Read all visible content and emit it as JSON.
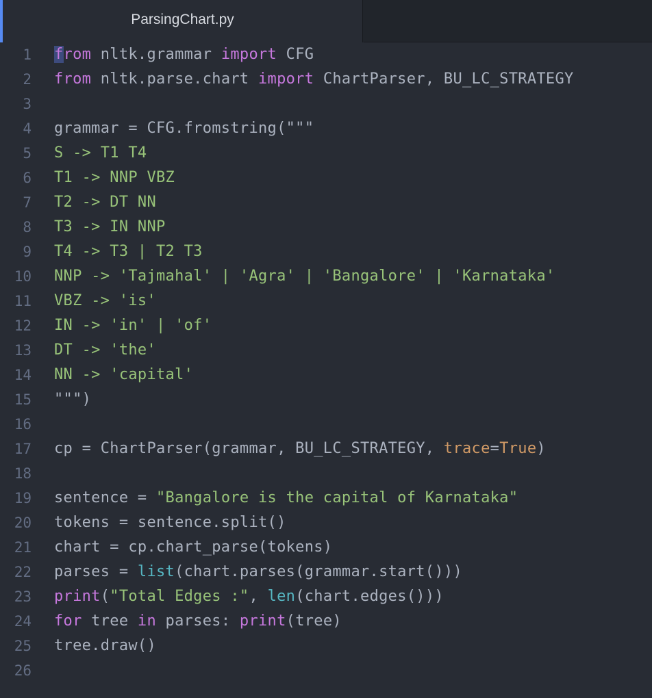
{
  "tab": {
    "title": "ParsingChart.py"
  },
  "colors": {
    "keyword": "#c678dd",
    "plain": "#abb2bf",
    "string": "#98c379",
    "builtin": "#56b6c2",
    "param": "#d19a66",
    "constant": "#d19a66"
  },
  "lines": [
    {
      "n": "1",
      "tokens": [
        {
          "t": "from",
          "c": "keyword"
        },
        {
          "t": " nltk.grammar ",
          "c": "plain"
        },
        {
          "t": "import",
          "c": "keyword"
        },
        {
          "t": " CFG",
          "c": "plain"
        }
      ]
    },
    {
      "n": "2",
      "tokens": [
        {
          "t": "from",
          "c": "keyword"
        },
        {
          "t": " nltk.parse.chart ",
          "c": "plain"
        },
        {
          "t": "import",
          "c": "keyword"
        },
        {
          "t": " ChartParser, BU_LC_STRATEGY",
          "c": "plain"
        }
      ]
    },
    {
      "n": "3",
      "tokens": []
    },
    {
      "n": "4",
      "tokens": [
        {
          "t": "grammar = CFG.fromstring(",
          "c": "plain"
        },
        {
          "t": "\"\"\"",
          "c": "plain"
        }
      ]
    },
    {
      "n": "5",
      "tokens": [
        {
          "t": "S -> T1 T4",
          "c": "string"
        }
      ]
    },
    {
      "n": "6",
      "tokens": [
        {
          "t": "T1 -> NNP VBZ",
          "c": "string"
        }
      ]
    },
    {
      "n": "7",
      "tokens": [
        {
          "t": "T2 -> DT NN",
          "c": "string"
        }
      ]
    },
    {
      "n": "8",
      "tokens": [
        {
          "t": "T3 -> IN NNP",
          "c": "string"
        }
      ]
    },
    {
      "n": "9",
      "tokens": [
        {
          "t": "T4 -> T3 | T2 T3",
          "c": "string"
        }
      ]
    },
    {
      "n": "10",
      "tokens": [
        {
          "t": "NNP -> 'Tajmahal' | 'Agra' | 'Bangalore' | 'Karnataka'",
          "c": "string"
        }
      ]
    },
    {
      "n": "11",
      "tokens": [
        {
          "t": "VBZ -> 'is'",
          "c": "string"
        }
      ]
    },
    {
      "n": "12",
      "tokens": [
        {
          "t": "IN -> 'in' | 'of'",
          "c": "string"
        }
      ]
    },
    {
      "n": "13",
      "tokens": [
        {
          "t": "DT -> 'the'",
          "c": "string"
        }
      ]
    },
    {
      "n": "14",
      "tokens": [
        {
          "t": "NN -> 'capital'",
          "c": "string"
        }
      ]
    },
    {
      "n": "15",
      "tokens": [
        {
          "t": "\"\"\"",
          "c": "plain"
        },
        {
          "t": ")",
          "c": "plain"
        }
      ]
    },
    {
      "n": "16",
      "tokens": []
    },
    {
      "n": "17",
      "tokens": [
        {
          "t": "cp = ChartParser(grammar, BU_LC_STRATEGY, ",
          "c": "plain"
        },
        {
          "t": "trace",
          "c": "param"
        },
        {
          "t": "=",
          "c": "plain"
        },
        {
          "t": "True",
          "c": "constant"
        },
        {
          "t": ")",
          "c": "plain"
        }
      ]
    },
    {
      "n": "18",
      "tokens": []
    },
    {
      "n": "19",
      "tokens": [
        {
          "t": "sentence = ",
          "c": "plain"
        },
        {
          "t": "\"Bangalore is the capital of Karnataka\"",
          "c": "string"
        }
      ]
    },
    {
      "n": "20",
      "tokens": [
        {
          "t": "tokens = sentence.split()",
          "c": "plain"
        }
      ]
    },
    {
      "n": "21",
      "tokens": [
        {
          "t": "chart = cp.chart_parse(tokens)",
          "c": "plain"
        }
      ]
    },
    {
      "n": "22",
      "tokens": [
        {
          "t": "parses = ",
          "c": "plain"
        },
        {
          "t": "list",
          "c": "builtin"
        },
        {
          "t": "(chart.parses(grammar.start()))",
          "c": "plain"
        }
      ]
    },
    {
      "n": "23",
      "tokens": [
        {
          "t": "print",
          "c": "keyword"
        },
        {
          "t": "(",
          "c": "plain"
        },
        {
          "t": "\"Total Edges :\"",
          "c": "string"
        },
        {
          "t": ", ",
          "c": "plain"
        },
        {
          "t": "len",
          "c": "builtin"
        },
        {
          "t": "(chart.edges()))",
          "c": "plain"
        }
      ]
    },
    {
      "n": "24",
      "tokens": [
        {
          "t": "for",
          "c": "keyword"
        },
        {
          "t": " tree ",
          "c": "plain"
        },
        {
          "t": "in",
          "c": "keyword"
        },
        {
          "t": " parses: ",
          "c": "plain"
        },
        {
          "t": "print",
          "c": "keyword"
        },
        {
          "t": "(tree)",
          "c": "plain"
        }
      ]
    },
    {
      "n": "25",
      "tokens": [
        {
          "t": "tree.draw()",
          "c": "plain"
        }
      ]
    },
    {
      "n": "26",
      "tokens": []
    }
  ]
}
